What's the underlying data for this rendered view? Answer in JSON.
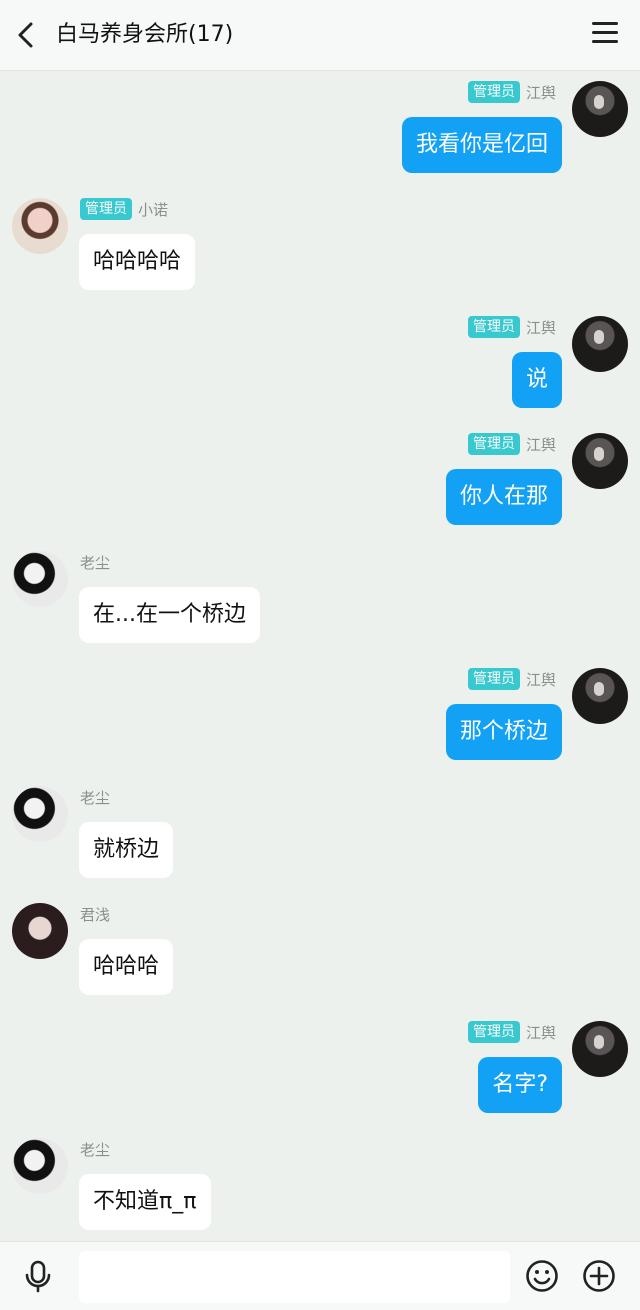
{
  "header": {
    "title": "白马养身会所(17)",
    "back_icon": "chevron-left-icon",
    "menu_icon": "menu-icon"
  },
  "messages": [
    {
      "side": "right",
      "badge": "管理员",
      "sender": "江舆",
      "text": "我看你是亿回",
      "avatar": "jiang"
    },
    {
      "side": "left",
      "badge": "管理员",
      "sender": "小诺",
      "text": "哈哈哈哈",
      "avatar": "xiaonuo"
    },
    {
      "side": "right",
      "badge": "管理员",
      "sender": "江舆",
      "text": "说",
      "avatar": "jiang"
    },
    {
      "side": "right",
      "badge": "管理员",
      "sender": "江舆",
      "text": "你人在那",
      "avatar": "jiang"
    },
    {
      "side": "left",
      "badge": "",
      "sender": "老尘",
      "text": "在...在一个桥边",
      "avatar": "laochen"
    },
    {
      "side": "right",
      "badge": "管理员",
      "sender": "江舆",
      "text": "那个桥边",
      "avatar": "jiang"
    },
    {
      "side": "left",
      "badge": "",
      "sender": "老尘",
      "text": "就桥边",
      "avatar": "laochen"
    },
    {
      "side": "left",
      "badge": "",
      "sender": "君浅",
      "text": "哈哈哈",
      "avatar": "junqian"
    },
    {
      "side": "right",
      "badge": "管理员",
      "sender": "江舆",
      "text": "名字?",
      "avatar": "jiang"
    },
    {
      "side": "left",
      "badge": "",
      "sender": "老尘",
      "text": "不知道π_π",
      "avatar": "laochen"
    }
  ],
  "composer": {
    "input_value": "",
    "mic_icon": "microphone-icon",
    "emoji_icon": "emoji-icon",
    "plus_icon": "plus-circle-icon"
  },
  "colors": {
    "accent": "#12a1f5",
    "badge": "#37c9cf",
    "background": "#ecf1ee"
  }
}
